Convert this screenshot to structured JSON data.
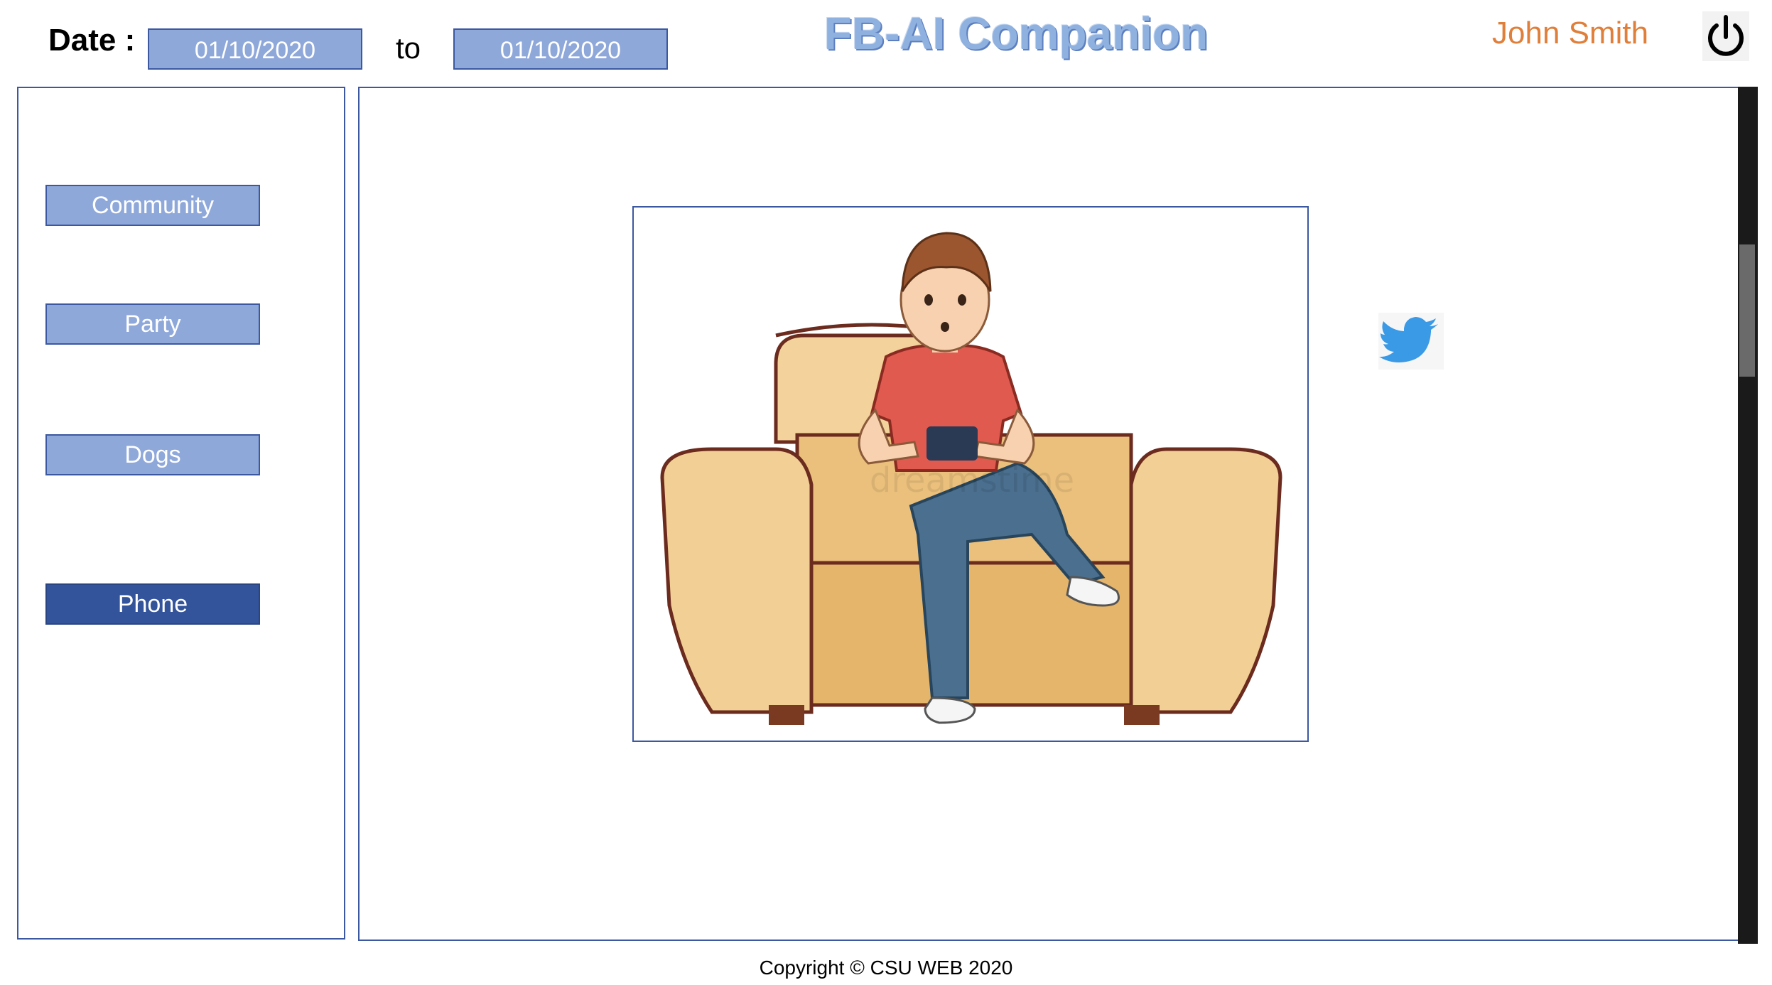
{
  "header": {
    "date_label": "Date :",
    "date_from": "01/10/2020",
    "to_label": "to",
    "date_to": "01/10/2020",
    "app_title": "FB-AI Companion",
    "user_name": "John Smith",
    "power_icon": "power-icon"
  },
  "sidebar": {
    "items": [
      {
        "label": "Community",
        "active": false
      },
      {
        "label": "Party",
        "active": false
      },
      {
        "label": "Dogs",
        "active": false
      },
      {
        "label": "Phone",
        "active": true
      }
    ]
  },
  "main": {
    "image_alt": "person-on-armchair-illustration",
    "watermark": "dreamstime",
    "social_icon": "twitter-icon"
  },
  "footer": {
    "copyright": "Copyright © CSU WEB 2020"
  },
  "colors": {
    "accent": "#8fa8da",
    "accent_dark": "#33549a",
    "border": "#3c58a0",
    "title": "#8fb1e0",
    "user": "#e07f3a",
    "twitter": "#3a9ae6"
  }
}
